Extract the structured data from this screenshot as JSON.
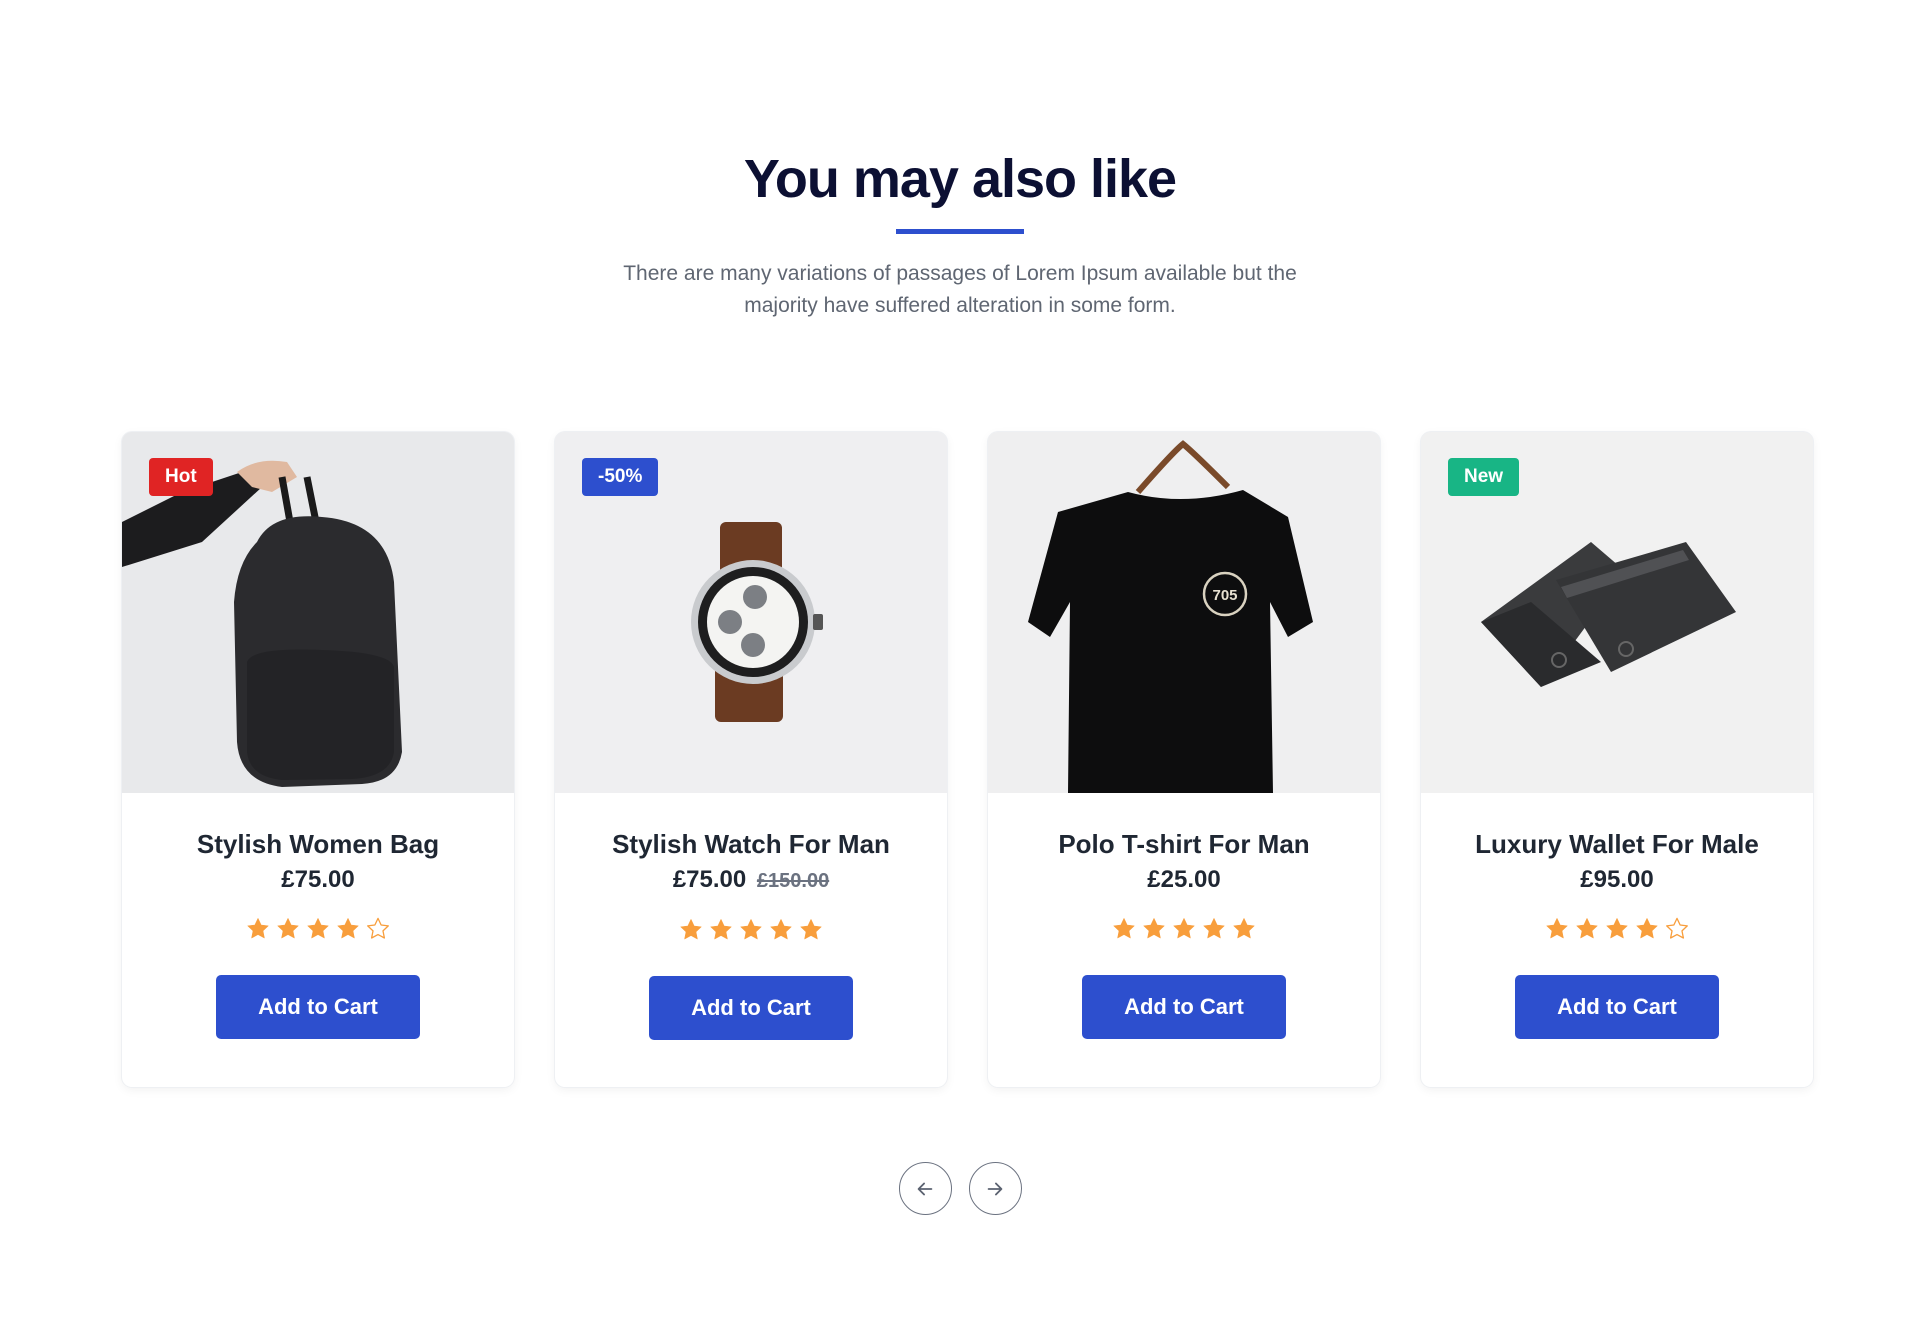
{
  "section": {
    "title": "You may also like",
    "subtitle": "There are many variations of passages of Lorem Ipsum available but the majority have suffered alteration in some form."
  },
  "colors": {
    "accent": "#2d4fce",
    "star": "#f89e3c",
    "badge_hot": "#e02424",
    "badge_sale": "#2d4fce",
    "badge_new": "#18b585"
  },
  "products": [
    {
      "name": "Stylish Women Bag",
      "price": "£75.00",
      "old_price": "",
      "badge": "Hot",
      "badge_type": "hot",
      "rating": 4,
      "rating_max": 5,
      "image": "backpack-photo",
      "cta": "Add to Cart"
    },
    {
      "name": "Stylish Watch For Man",
      "price": "£75.00",
      "old_price": "£150.00",
      "badge": "-50%",
      "badge_type": "sale",
      "rating": 5,
      "rating_max": 5,
      "image": "watch-photo",
      "cta": "Add to Cart"
    },
    {
      "name": "Polo T-shirt For Man",
      "price": "£25.00",
      "old_price": "",
      "badge": "",
      "badge_type": "",
      "rating": 5,
      "rating_max": 5,
      "image": "tshirt-photo",
      "cta": "Add to Cart"
    },
    {
      "name": "Luxury Wallet For Male",
      "price": "£95.00",
      "old_price": "",
      "badge": "New",
      "badge_type": "new",
      "rating": 4,
      "rating_max": 5,
      "image": "wallet-photo",
      "cta": "Add to Cart"
    }
  ],
  "carousel": {
    "prev_icon": "arrow-left-icon",
    "next_icon": "arrow-right-icon"
  }
}
